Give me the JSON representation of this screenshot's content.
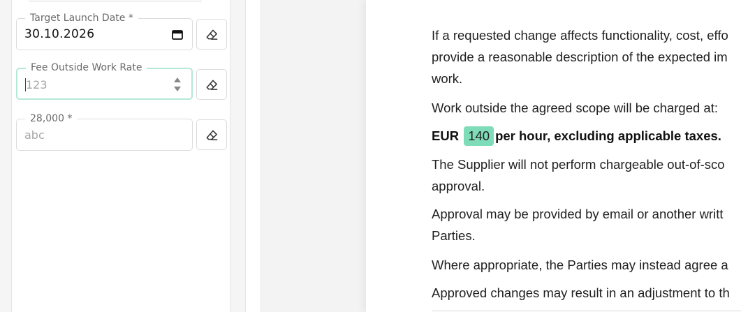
{
  "form": {
    "fields": [
      {
        "legend": "Target Launch Date *",
        "value": "30.10.2026",
        "type": "date"
      },
      {
        "legend": "Fee Outside Work Rate",
        "placeholder": "123",
        "type": "number"
      },
      {
        "legend": "28,000 *",
        "placeholder": "abc",
        "type": "text"
      }
    ]
  },
  "document": {
    "p1_line1": "If a requested change affects functionality, cost, effo",
    "p1_line2": "provide a reasonable description of the expected im",
    "p1_line3": "work.",
    "p2": "Work outside the agreed scope will be charged at:",
    "p3_prefix": "EUR",
    "p3_value": "140",
    "p3_suffix": "per hour, excluding applicable taxes.",
    "p4_line1": "The Supplier will not perform chargeable out-of-sco",
    "p4_line2": "approval.",
    "p5_line1": "Approval may be provided by email or another writt",
    "p5_line2": "Parties.",
    "p6": "Where appropriate, the Parties may instead agree a",
    "p7": "Approved changes may result in an adjustment to th"
  },
  "colors": {
    "highlight": "#7fdcb8",
    "active_border": "#b4e8d7"
  }
}
